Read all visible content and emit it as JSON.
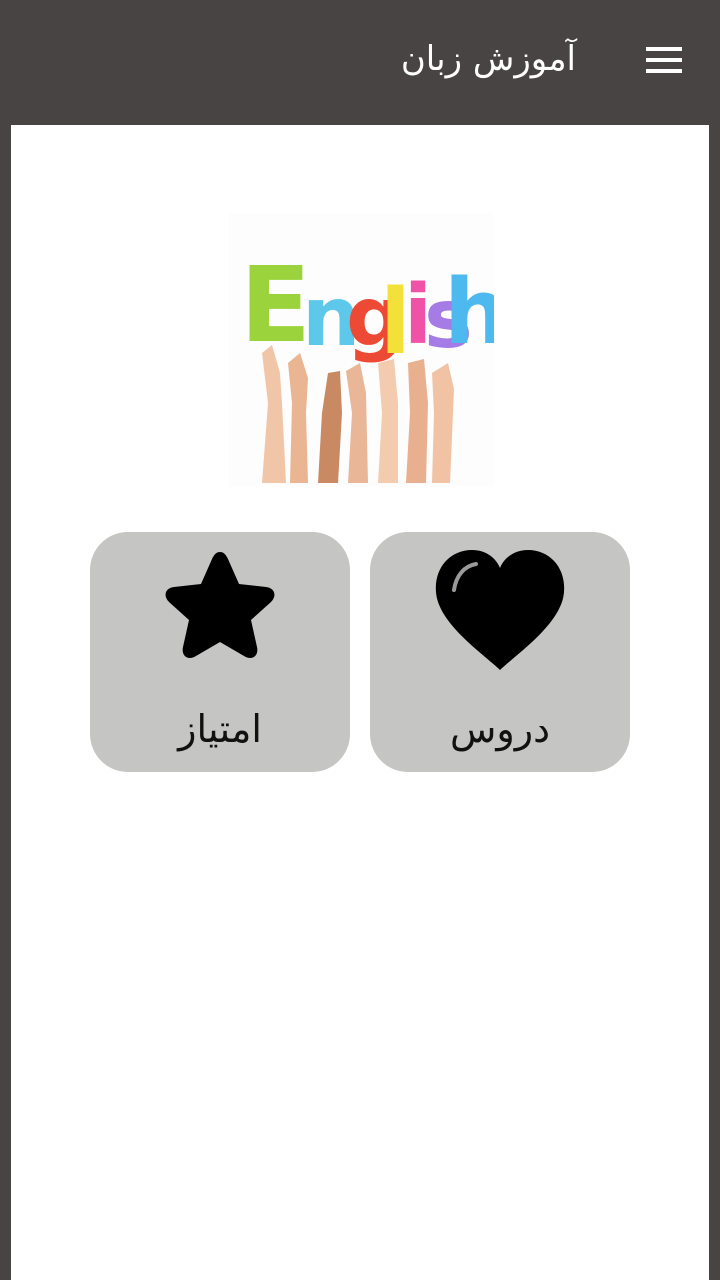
{
  "app_bar": {
    "title": "آموزش زبان",
    "menu_icon": "hamburger-menu-icon",
    "background": "#484444"
  },
  "hero": {
    "word": "English",
    "letters": [
      "E",
      "n",
      "g",
      "l",
      "i",
      "s",
      "h"
    ],
    "letter_colors": [
      "#9bd33c",
      "#5ec8ea",
      "#ec4a34",
      "#f3e13a",
      "#f052a8",
      "#a57be6",
      "#4db9ee"
    ]
  },
  "tiles": [
    {
      "label": "امتیاز",
      "icon": "star-icon"
    },
    {
      "label": "دروس",
      "icon": "heart-icon"
    }
  ],
  "colors": {
    "tile_background": "#c5c6c3",
    "content_background": "#ffffff"
  }
}
